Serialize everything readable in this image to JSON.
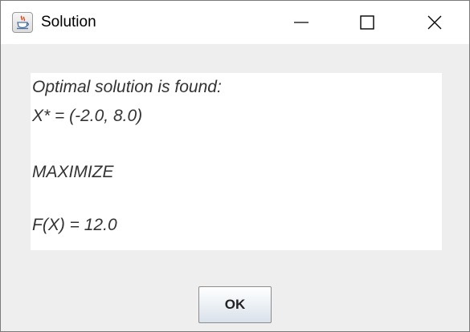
{
  "window": {
    "title": "Solution",
    "icon": "java-cup-icon",
    "controls": [
      "minimize-icon",
      "maximize-icon",
      "close-icon"
    ]
  },
  "message": {
    "line1": "Optimal solution is found:",
    "line2": "X* = (-2.0, 8.0)",
    "line3": "MAXIMIZE",
    "line4": "F(X) = 12.0"
  },
  "buttons": {
    "ok_label": "OK"
  }
}
